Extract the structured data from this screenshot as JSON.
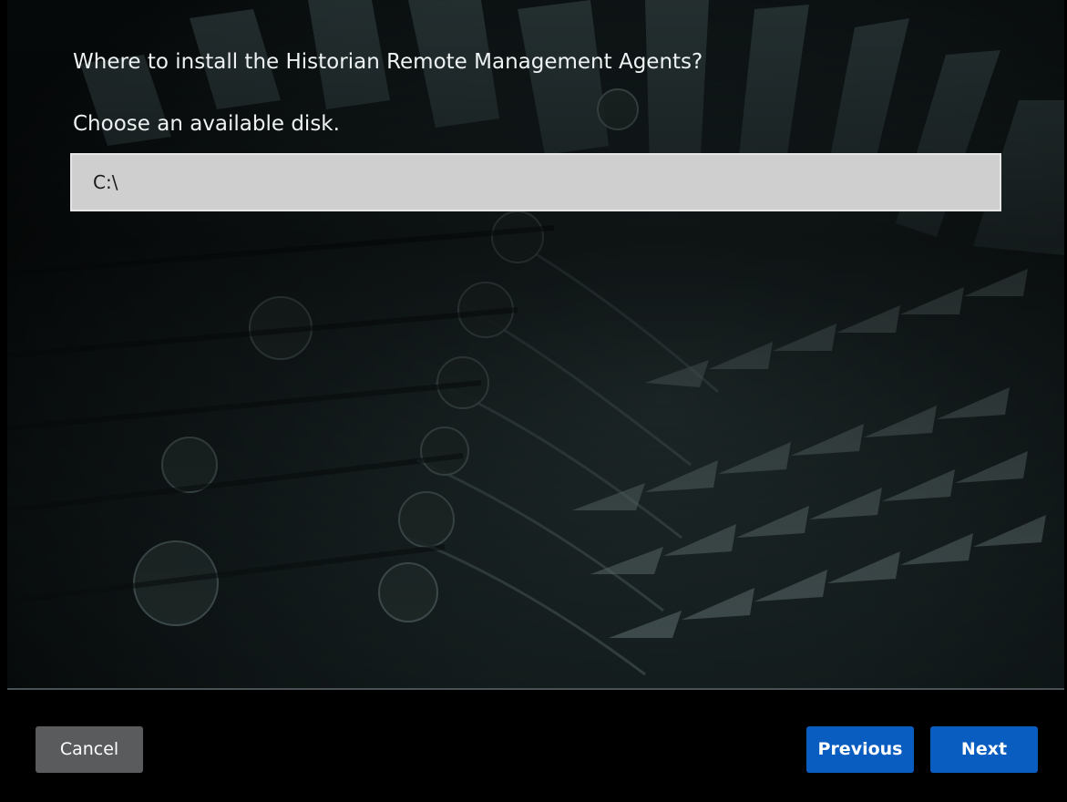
{
  "installer": {
    "question": "Where to install the Historian Remote Management Agents?",
    "instruction": "Choose an available disk.",
    "disk_selection": {
      "value": "C:\\"
    }
  },
  "footer": {
    "cancel_label": "Cancel",
    "previous_label": "Previous",
    "next_label": "Next"
  },
  "colors": {
    "primary_button": "#0a5dc0",
    "secondary_button": "#5a5b5c",
    "field_background": "#cfcfcf"
  }
}
